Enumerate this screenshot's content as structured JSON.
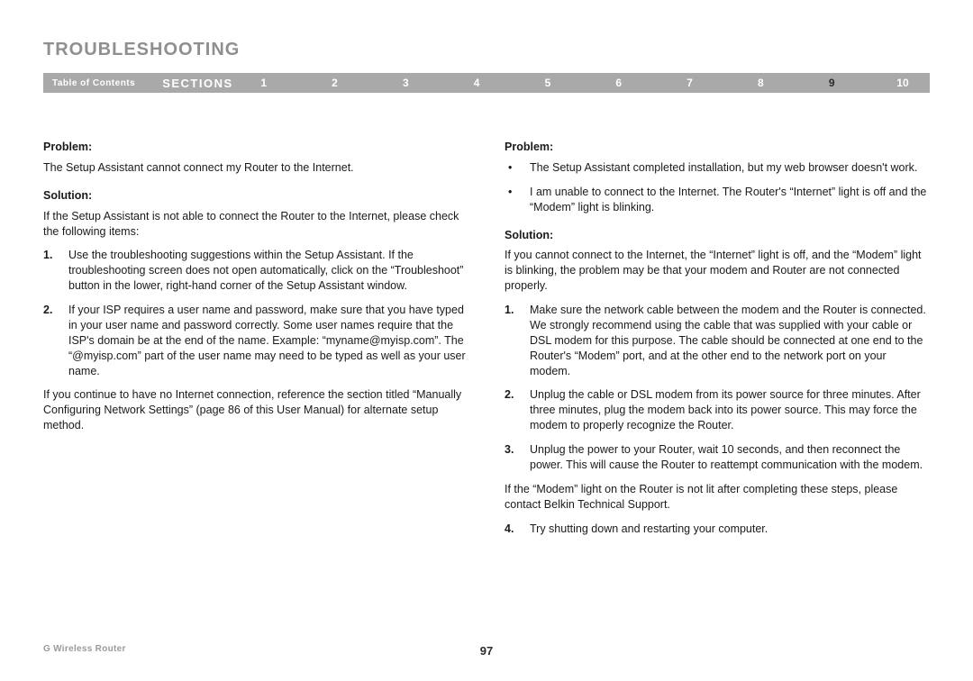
{
  "title": "TROUBLESHOOTING",
  "nav": {
    "toc": "Table of Contents",
    "sections_label": "SECTIONS",
    "items": [
      "1",
      "2",
      "3",
      "4",
      "5",
      "6",
      "7",
      "8",
      "9",
      "10"
    ],
    "active_index": 8
  },
  "left": {
    "problem_label": "Problem:",
    "problem_text": "The Setup Assistant cannot connect my Router to the Internet.",
    "solution_label": "Solution:",
    "solution_intro": "If the Setup Assistant is not able to connect the Router to the Internet, please check the following items:",
    "steps": [
      "Use the troubleshooting suggestions within the Setup Assistant. If the troubleshooting screen does not open automatically, click on the “Troubleshoot” button in the lower, right-hand corner of the Setup Assistant window.",
      "If your ISP requires a user name and password, make sure that you have typed in your user name and password correctly. Some user names require that the ISP's domain be at the end of the name. Example: “myname@myisp.com”. The “@myisp.com” part of the user name may need to be typed as well as your user name."
    ],
    "outro": "If you continue to have no Internet connection, reference the section titled “Manually Configuring Network Settings” (page 86 of this User Manual) for alternate setup method."
  },
  "right": {
    "problem_label": "Problem:",
    "bullets": [
      "The Setup Assistant completed installation, but my web browser doesn't work.",
      "I am unable to connect to the Internet. The Router's “Internet” light is off and the “Modem” light is blinking."
    ],
    "solution_label": "Solution:",
    "solution_intro": "If you cannot connect to the Internet, the “Internet” light is off, and the “Modem” light is blinking, the problem may be that your modem and Router are not connected properly.",
    "steps": [
      "Make sure the network cable between the modem and the Router is connected. We strongly recommend using the cable that was supplied with your cable or DSL modem for this purpose. The cable should be connected at one end to the Router's “Modem” port, and at the other end to the network port on your modem.",
      "Unplug the cable or DSL modem from its power source for three minutes. After three minutes, plug the modem back into its power source. This may force the modem to properly recognize the Router.",
      "Unplug the power to your Router, wait 10 seconds, and then reconnect the power. This will cause the Router to reattempt communication with the modem."
    ],
    "mid_note": "If the “Modem” light on the Router is not lit after completing these steps, please contact Belkin Technical Support.",
    "steps2": [
      "Try shutting down and restarting your computer."
    ]
  },
  "footer": {
    "product": "G Wireless Router",
    "page": "97"
  }
}
